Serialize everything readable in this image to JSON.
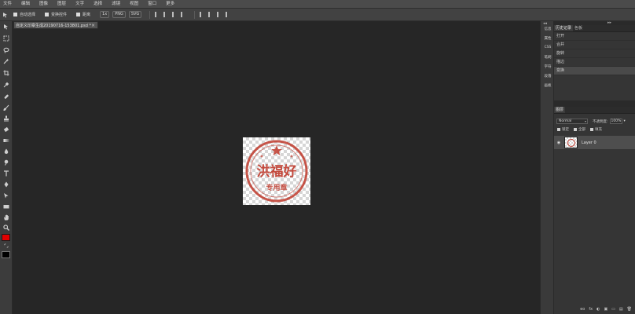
{
  "menu": [
    "文件",
    "编辑",
    "图像",
    "图层",
    "文字",
    "选择",
    "滤镜",
    "视图",
    "窗口",
    "更多"
  ],
  "options": {
    "auto_select": "自动选择",
    "transform_controls": "变换控件",
    "distance": "距离",
    "zoom_level": "1x",
    "png_label": "PNG",
    "svg_label": "SVG"
  },
  "document": {
    "tab_title": "自定义印章生成20190716-153801.psd *",
    "close_glyph": "×"
  },
  "minidock": {
    "collapse": "◂◂",
    "items": [
      "信息",
      "属性",
      "CSS",
      "笔刷",
      "字符",
      "段落",
      "画板"
    ]
  },
  "history_panel": {
    "collapse": "▸▸",
    "tabs": [
      "历史记录",
      "色板"
    ],
    "items": [
      "打开",
      "合并",
      "旋转",
      "描边",
      "变换"
    ],
    "selected_index": 4
  },
  "layers_panel": {
    "tab": "图层",
    "blend_mode": "Normal",
    "blend_arrow": "▾",
    "opacity_label": "不透明度:",
    "opacity_value": "100%",
    "opacity_arrow": "▾",
    "lock_labels": [
      "锁定",
      "全部",
      "填充"
    ],
    "layer_name": "Layer 0",
    "eye_glyph": "◉",
    "bottom_icons": [
      "eo",
      "fx",
      "◐",
      "▣",
      "▭",
      "▤",
      "🗑"
    ]
  },
  "stamp": {
    "big_text": "洪福好",
    "small_text": "专用章",
    "color": "#c0392b"
  },
  "colors": {
    "foreground": "#e00000",
    "background": "#000000"
  }
}
